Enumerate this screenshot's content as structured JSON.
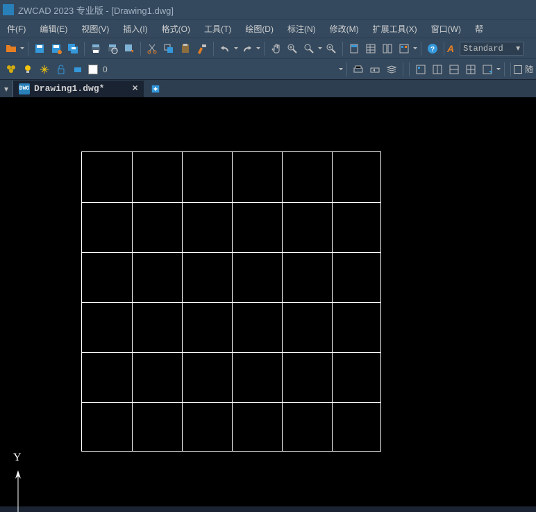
{
  "title": "ZWCAD 2023 专业版 - [Drawing1.dwg]",
  "menu": [
    {
      "label": "件(F)"
    },
    {
      "label": "编辑(E)"
    },
    {
      "label": "视图(V)"
    },
    {
      "label": "插入(I)"
    },
    {
      "label": "格式(O)"
    },
    {
      "label": "工具(T)"
    },
    {
      "label": "绘图(D)"
    },
    {
      "label": "标注(N)"
    },
    {
      "label": "修改(M)"
    },
    {
      "label": "扩展工具(X)"
    },
    {
      "label": "窗口(W)"
    },
    {
      "label": "帮"
    }
  ],
  "layer": {
    "current": "0"
  },
  "style": {
    "letter": "A",
    "name": "Standard"
  },
  "tab": {
    "name": "Drawing1.dwg*",
    "close": "×"
  },
  "axis": {
    "y": "Y"
  },
  "random_text": "随",
  "grid": {
    "rows": 6,
    "cols": 6
  }
}
